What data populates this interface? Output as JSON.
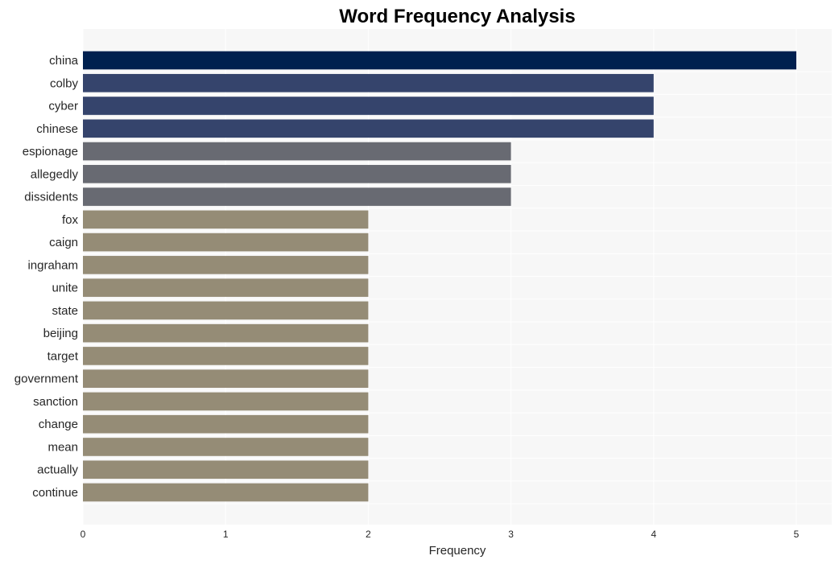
{
  "chart_data": {
    "type": "bar",
    "orientation": "horizontal",
    "title": "Word Frequency Analysis",
    "xlabel": "Frequency",
    "ylabel": "",
    "xlim": [
      0,
      5.25
    ],
    "xticks": [
      0,
      1,
      2,
      3,
      4,
      5
    ],
    "grid": true,
    "legend": null,
    "categories": [
      "china",
      "colby",
      "cyber",
      "chinese",
      "espionage",
      "allegedly",
      "dissidents",
      "fox",
      "caign",
      "ingraham",
      "unite",
      "state",
      "beijing",
      "target",
      "government",
      "sanction",
      "change",
      "mean",
      "actually",
      "continue"
    ],
    "values": [
      5,
      4,
      4,
      4,
      3,
      3,
      3,
      2,
      2,
      2,
      2,
      2,
      2,
      2,
      2,
      2,
      2,
      2,
      2,
      2
    ],
    "colors_by_value": {
      "5": "#00204f",
      "4": "#35446c",
      "3": "#686a72",
      "2": "#958c76"
    }
  },
  "colors": {
    "plot_background": "#f7f7f7",
    "grid": "#ffffff",
    "text": "#262626"
  }
}
